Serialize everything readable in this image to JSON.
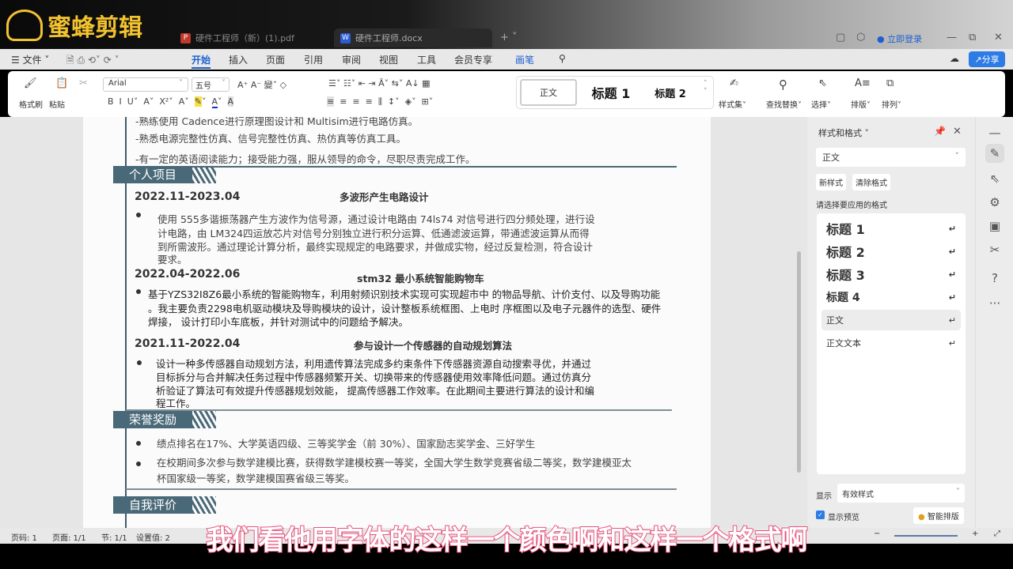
{
  "watermark": "蜜蜂剪辑",
  "tabs": [
    {
      "label": "硬件工程师（新）(1).pdf",
      "icon": "pdf-icon"
    },
    {
      "label": "硬件工程师.docx",
      "icon": "word-icon"
    }
  ],
  "login": "立即登录",
  "menu": {
    "file": "文件",
    "items": [
      "开始",
      "插入",
      "页面",
      "引用",
      "审阅",
      "视图",
      "工具",
      "会员专享"
    ],
    "active": "开始",
    "pen": "画笔",
    "share": "分享"
  },
  "ribbon": {
    "format_painter": "格式刷",
    "paste": "粘贴",
    "font": "Arial",
    "size": "五号",
    "styles": [
      "正文",
      "标题 1",
      "标题 2"
    ],
    "style_set": "样式集",
    "find_replace": "查找替换",
    "select": "选择",
    "layout": "排版",
    "arrange": "排列"
  },
  "doc": {
    "skills": [
      "-熟练使用 Cadence进行原理图设计和 Multisim进行电路仿真。",
      "-熟悉电源完整性仿真、信号完整性仿真、热仿真等仿真工具。",
      "-有一定的英语阅读能力；接受能力强，服从领导的命令，尽职尽责完成工作。"
    ],
    "sections": [
      "个人项目",
      "荣誉奖励",
      "自我评价"
    ],
    "projects": [
      {
        "date": "2022.11-2023.04",
        "title": "多波形产生电路设计",
        "lines": [
          "使用 555多谐振荡器产生方波作为信号源，通过设计电路由 74ls74 对信号进行四分频处理，进行设",
          "计电路，由 LM324四运放芯片对信号分别独立进行积分运算、低通滤波运算，带通滤波运算从而得",
          "到所需波形。通过理论计算分析，最终实现规定的电路要求，并做成实物，经过反复检测，符合设计",
          "要求。"
        ]
      },
      {
        "date": "2022.04-2022.06",
        "title": "stm32 最小系统智能购物车",
        "lines": [
          "基于YZS32I8Z6最小系统的智能购物车，利用射频识别技术实现可实现超市中   的物品导航、计价支付、以及导购功能",
          "。我主要负责2298电机驱动模块及导购模块的设计，设计整板系统框图、上电时 序框图以及电子元器件的选型、硬件",
          "焊接，   设计打印小车底板，并针对测试中的问题给予解决。"
        ]
      },
      {
        "date": "2021.11-2022.04",
        "title": "参与设计一个传感器的自动规划算法",
        "lines": [
          "设计一种多传感器自动规划方法，利用遗传算法完成多约束条件下传感器资源自动搜索寻优，并通过",
          "目标拆分与合并解决任务过程中传感器频繁开关、切换带来的传感器使用效率降低问题。通过仿真分",
          "析验证了算法可有效提升传感器规划效能，  提高传感器工作效率。在此期间主要进行算法的设计和编",
          "程工作。"
        ]
      }
    ],
    "awards": [
      "绩点排名在17%、大学英语四级、三等奖学金（前 30%）、国家励志奖学金、三好学生",
      "在校期间多次参与数学建模比赛，获得数学建模校赛一等奖，全国大学生数学竞赛省级二等奖，数学建模亚太",
      "杯国家级一等奖，数学建模国赛省级三等奖。"
    ]
  },
  "panel": {
    "title": "样式和格式",
    "current": "正文",
    "new_style": "新样式",
    "clear_format": "清除格式",
    "prompt": "请选择要应用的格式",
    "styles": [
      "标题 1",
      "标题 2",
      "标题 3",
      "标题 4",
      "正文",
      "正文文本"
    ],
    "show_label": "显示",
    "show_value": "有效样式",
    "preview": "显示预览",
    "preview_checked": true,
    "smart_layout": "智能排版"
  },
  "status": {
    "page_num": "页码: 1",
    "pages": "页面: 1/1",
    "section": "节: 1/1",
    "setting": "设置值: 2"
  },
  "subtitle": "我们看他用字体的这样一个颜色啊和这样一个格式啊"
}
